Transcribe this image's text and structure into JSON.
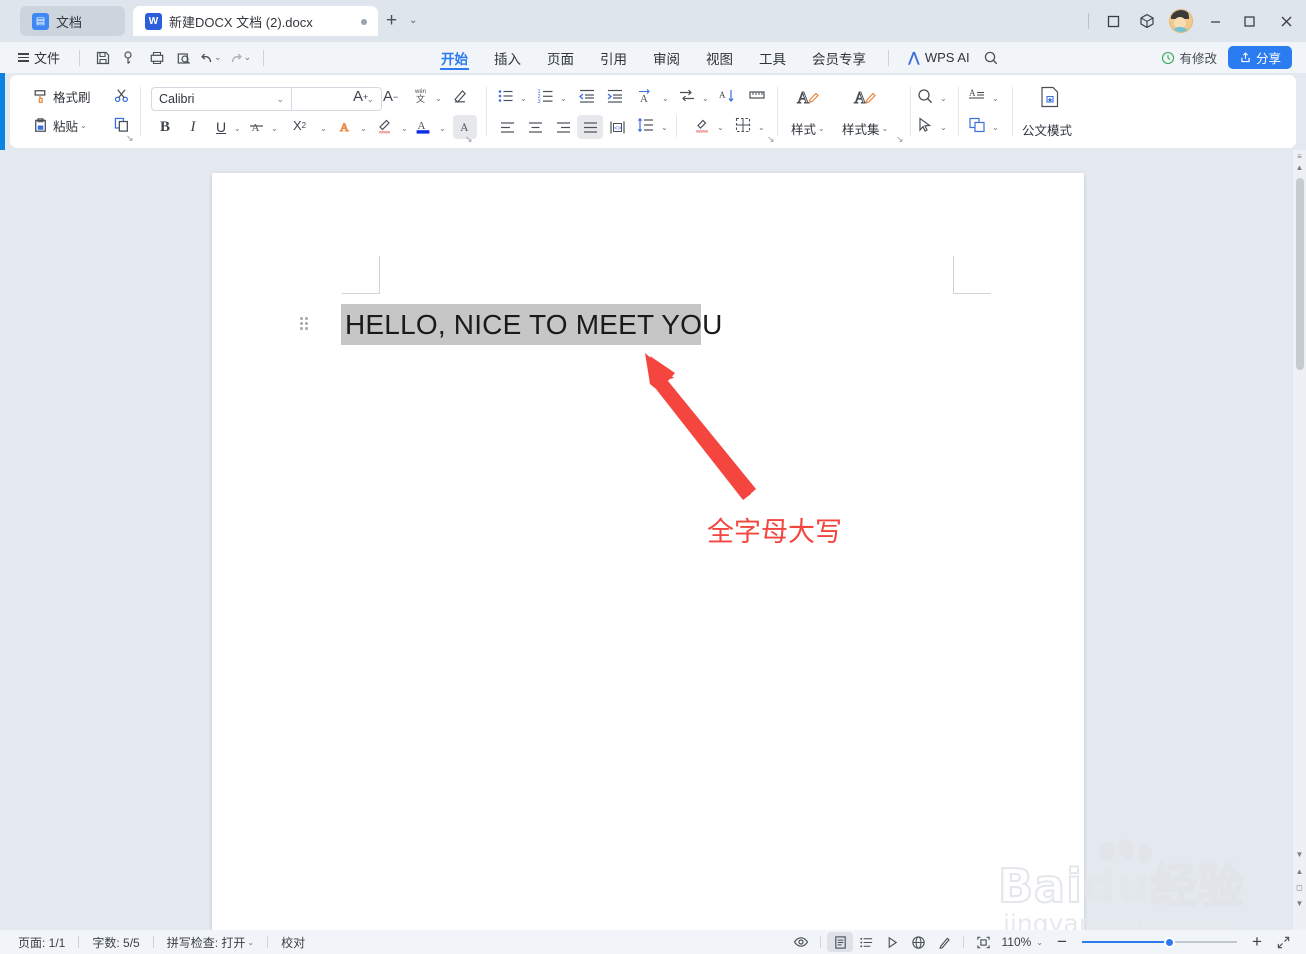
{
  "titlebar": {
    "doc_tab_label": "文档",
    "file_tab_label": "新建DOCX 文档 (2).docx",
    "new_tab_label": "+",
    "new_tab_caret": "⌄",
    "window_icons": [
      "restore-icon",
      "cube-icon",
      "avatar",
      "minimize-icon",
      "maximize-icon",
      "close-icon"
    ]
  },
  "menubar": {
    "file_label": "文件",
    "quick_icons": [
      "save-icon",
      "save-as-icon",
      "print-icon",
      "print-preview-icon",
      "undo-icon",
      "redo-icon",
      "more-icon"
    ],
    "tabs": [
      {
        "label": "开始",
        "active": true
      },
      {
        "label": "插入",
        "active": false
      },
      {
        "label": "页面",
        "active": false
      },
      {
        "label": "引用",
        "active": false
      },
      {
        "label": "审阅",
        "active": false
      },
      {
        "label": "视图",
        "active": false
      },
      {
        "label": "工具",
        "active": false
      },
      {
        "label": "会员专享",
        "active": false
      }
    ],
    "wps_ai_label": "WPS AI",
    "search_icon": "search-icon",
    "modified_label": "有修改",
    "share_label": "分享"
  },
  "ribbon": {
    "format_painter_label": "格式刷",
    "paste_label": "粘贴",
    "cut_icon": "scissors-icon",
    "copy_icon": "copy-icon",
    "font_name": "Calibri",
    "font_size": "",
    "grow_font_icon": "grow-font-icon",
    "shrink_font_icon": "shrink-font-icon",
    "pinyin_icon": "pinyin-guide-icon",
    "clear_format_icon": "clear-format-icon",
    "bold_label": "B",
    "italic_label": "I",
    "underline_label": "U",
    "strikethrough_icon": "strikethrough-icon",
    "superscript_label": "X²",
    "text_effect_icon": "text-effect-icon",
    "highlight_icon": "highlight-icon",
    "font_color_icon": "font-color-icon",
    "change_case_icon": "change-case-icon",
    "bullets_icon": "bullets-icon",
    "numbering_icon": "numbering-icon",
    "decrease_indent_icon": "decrease-indent-icon",
    "increase_indent_icon": "increase-indent-icon",
    "text_direction_icon": "asian-layout-icon",
    "sort_icon": "sort-icon",
    "show_marks_icon": "show-paragraph-marks-icon",
    "align_left_icon": "align-left-icon",
    "align_center_icon": "align-center-icon",
    "align_right_icon": "align-right-icon",
    "align_justify_icon": "align-justify-icon",
    "distribute_icon": "distribute-icon",
    "line_spacing_icon": "line-spacing-icon",
    "shading_icon": "shading-icon",
    "borders_icon": "borders-icon",
    "style_label": "样式",
    "style_set_label": "样式集",
    "find_icon": "find-icon",
    "select_icon": "select-pointer-icon",
    "text_tools_icon": "text-tools-icon",
    "arrange_icon": "arrange-objects-icon",
    "gov_doc_label": "公文模式"
  },
  "document": {
    "body_text": "HELLO, NICE TO MEET YOU",
    "annotation_text": "全字母大写",
    "annotation_color": "#f4463f",
    "selection_color": "#c6c6c6"
  },
  "watermark": {
    "main": "Bai  u",
    "cn": "经验",
    "sub": "jingyan.baidu.com"
  },
  "statusbar": {
    "page_label": "页面: 1/1",
    "word_count_label": "字数: 5/5",
    "spellcheck_label": "拼写检查: 打开",
    "proofread_label": "校对",
    "view_icons": [
      "eye-icon",
      "page-view-icon",
      "outline-view-icon",
      "read-view-icon",
      "web-view-icon",
      "edit-pen-icon",
      "fullscreen-focus-icon"
    ],
    "zoom_label": "110%",
    "zoom_out_label": "−",
    "zoom_in_label": "+",
    "expand_icon": "expand-icon"
  }
}
